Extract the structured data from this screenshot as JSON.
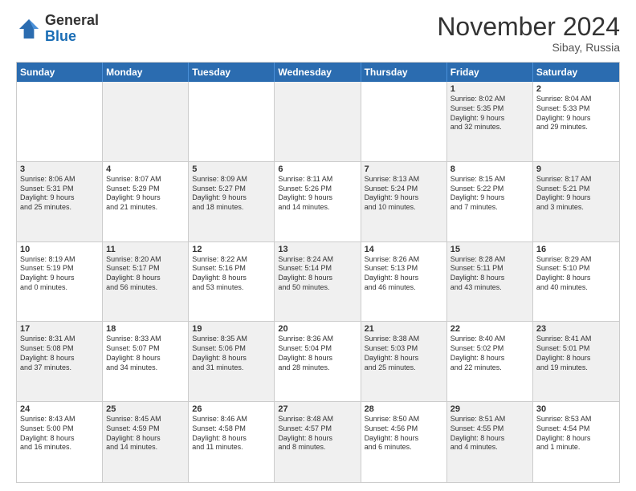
{
  "header": {
    "logo": {
      "general": "General",
      "blue": "Blue"
    },
    "month": "November 2024",
    "location": "Sibay, Russia"
  },
  "days_of_week": [
    "Sunday",
    "Monday",
    "Tuesday",
    "Wednesday",
    "Thursday",
    "Friday",
    "Saturday"
  ],
  "weeks": [
    [
      {
        "day": "",
        "empty": true,
        "shade": "white"
      },
      {
        "day": "",
        "empty": true,
        "shade": "shaded"
      },
      {
        "day": "",
        "empty": true,
        "shade": "white"
      },
      {
        "day": "",
        "empty": true,
        "shade": "shaded"
      },
      {
        "day": "",
        "empty": true,
        "shade": "white"
      },
      {
        "day": "1",
        "info": "Sunrise: 8:02 AM\nSunset: 5:35 PM\nDaylight: 9 hours\nand 32 minutes.",
        "shade": "shaded"
      },
      {
        "day": "2",
        "info": "Sunrise: 8:04 AM\nSunset: 5:33 PM\nDaylight: 9 hours\nand 29 minutes.",
        "shade": "white"
      }
    ],
    [
      {
        "day": "3",
        "info": "Sunrise: 8:06 AM\nSunset: 5:31 PM\nDaylight: 9 hours\nand 25 minutes.",
        "shade": "shaded"
      },
      {
        "day": "4",
        "info": "Sunrise: 8:07 AM\nSunset: 5:29 PM\nDaylight: 9 hours\nand 21 minutes.",
        "shade": "white"
      },
      {
        "day": "5",
        "info": "Sunrise: 8:09 AM\nSunset: 5:27 PM\nDaylight: 9 hours\nand 18 minutes.",
        "shade": "shaded"
      },
      {
        "day": "6",
        "info": "Sunrise: 8:11 AM\nSunset: 5:26 PM\nDaylight: 9 hours\nand 14 minutes.",
        "shade": "white"
      },
      {
        "day": "7",
        "info": "Sunrise: 8:13 AM\nSunset: 5:24 PM\nDaylight: 9 hours\nand 10 minutes.",
        "shade": "shaded"
      },
      {
        "day": "8",
        "info": "Sunrise: 8:15 AM\nSunset: 5:22 PM\nDaylight: 9 hours\nand 7 minutes.",
        "shade": "white"
      },
      {
        "day": "9",
        "info": "Sunrise: 8:17 AM\nSunset: 5:21 PM\nDaylight: 9 hours\nand 3 minutes.",
        "shade": "shaded"
      }
    ],
    [
      {
        "day": "10",
        "info": "Sunrise: 8:19 AM\nSunset: 5:19 PM\nDaylight: 9 hours\nand 0 minutes.",
        "shade": "white"
      },
      {
        "day": "11",
        "info": "Sunrise: 8:20 AM\nSunset: 5:17 PM\nDaylight: 8 hours\nand 56 minutes.",
        "shade": "shaded"
      },
      {
        "day": "12",
        "info": "Sunrise: 8:22 AM\nSunset: 5:16 PM\nDaylight: 8 hours\nand 53 minutes.",
        "shade": "white"
      },
      {
        "day": "13",
        "info": "Sunrise: 8:24 AM\nSunset: 5:14 PM\nDaylight: 8 hours\nand 50 minutes.",
        "shade": "shaded"
      },
      {
        "day": "14",
        "info": "Sunrise: 8:26 AM\nSunset: 5:13 PM\nDaylight: 8 hours\nand 46 minutes.",
        "shade": "white"
      },
      {
        "day": "15",
        "info": "Sunrise: 8:28 AM\nSunset: 5:11 PM\nDaylight: 8 hours\nand 43 minutes.",
        "shade": "shaded"
      },
      {
        "day": "16",
        "info": "Sunrise: 8:29 AM\nSunset: 5:10 PM\nDaylight: 8 hours\nand 40 minutes.",
        "shade": "white"
      }
    ],
    [
      {
        "day": "17",
        "info": "Sunrise: 8:31 AM\nSunset: 5:08 PM\nDaylight: 8 hours\nand 37 minutes.",
        "shade": "shaded"
      },
      {
        "day": "18",
        "info": "Sunrise: 8:33 AM\nSunset: 5:07 PM\nDaylight: 8 hours\nand 34 minutes.",
        "shade": "white"
      },
      {
        "day": "19",
        "info": "Sunrise: 8:35 AM\nSunset: 5:06 PM\nDaylight: 8 hours\nand 31 minutes.",
        "shade": "shaded"
      },
      {
        "day": "20",
        "info": "Sunrise: 8:36 AM\nSunset: 5:04 PM\nDaylight: 8 hours\nand 28 minutes.",
        "shade": "white"
      },
      {
        "day": "21",
        "info": "Sunrise: 8:38 AM\nSunset: 5:03 PM\nDaylight: 8 hours\nand 25 minutes.",
        "shade": "shaded"
      },
      {
        "day": "22",
        "info": "Sunrise: 8:40 AM\nSunset: 5:02 PM\nDaylight: 8 hours\nand 22 minutes.",
        "shade": "white"
      },
      {
        "day": "23",
        "info": "Sunrise: 8:41 AM\nSunset: 5:01 PM\nDaylight: 8 hours\nand 19 minutes.",
        "shade": "shaded"
      }
    ],
    [
      {
        "day": "24",
        "info": "Sunrise: 8:43 AM\nSunset: 5:00 PM\nDaylight: 8 hours\nand 16 minutes.",
        "shade": "white"
      },
      {
        "day": "25",
        "info": "Sunrise: 8:45 AM\nSunset: 4:59 PM\nDaylight: 8 hours\nand 14 minutes.",
        "shade": "shaded"
      },
      {
        "day": "26",
        "info": "Sunrise: 8:46 AM\nSunset: 4:58 PM\nDaylight: 8 hours\nand 11 minutes.",
        "shade": "white"
      },
      {
        "day": "27",
        "info": "Sunrise: 8:48 AM\nSunset: 4:57 PM\nDaylight: 8 hours\nand 8 minutes.",
        "shade": "shaded"
      },
      {
        "day": "28",
        "info": "Sunrise: 8:50 AM\nSunset: 4:56 PM\nDaylight: 8 hours\nand 6 minutes.",
        "shade": "white"
      },
      {
        "day": "29",
        "info": "Sunrise: 8:51 AM\nSunset: 4:55 PM\nDaylight: 8 hours\nand 4 minutes.",
        "shade": "shaded"
      },
      {
        "day": "30",
        "info": "Sunrise: 8:53 AM\nSunset: 4:54 PM\nDaylight: 8 hours\nand 1 minute.",
        "shade": "white"
      }
    ]
  ]
}
